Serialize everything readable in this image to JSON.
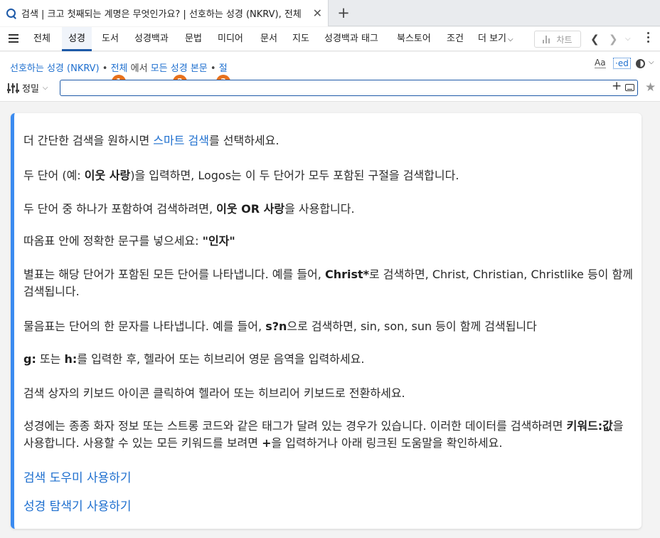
{
  "browser_tab": {
    "title": "검색 | 크고 첫째되는 계명은 무엇인가요? | 선호하는 성경 (NKRV), 전체",
    "close": "✕",
    "new_tab": "+"
  },
  "menu": {
    "items": [
      "전체",
      "성경",
      "도서",
      "성경백과",
      "문법",
      "미디어",
      "문서",
      "지도",
      "성경백과 태그",
      "북스토어",
      "조건",
      "더 보기"
    ],
    "more_caret": "⌵",
    "chart_label": "차트",
    "back": "❮",
    "forward": "❯",
    "forward_caret": "⌵"
  },
  "search": {
    "breadcrumb": {
      "bible": "선호하는 성경 (NKRV)",
      "sep1": "•",
      "scope": "전체",
      "in_text": "에서",
      "field": "모든 성경 본문",
      "sep2": "•",
      "unit": "절"
    },
    "badges": [
      "1",
      "2",
      "3"
    ],
    "aa_label": "Aa",
    "ed_label": "·ed",
    "caret": "⌵",
    "precision_label": "정밀",
    "precision_caret": "⌵",
    "input_value": "",
    "input_placeholder": "",
    "plus": "+",
    "star": "★"
  },
  "help": {
    "p1": {
      "a": "더 간단한 검색을 원하시면 ",
      "link": "스마트 검색",
      "b": "를 선택하세요."
    },
    "p2": {
      "a": "두 단어 (예: ",
      "bold": "이웃 사랑",
      "b": ")을 입력하면, Logos는 이 두 단어가 모두 포함된 구절을 검색합니다."
    },
    "p3": {
      "a": "두 단어 중 하나가 포함하여 검색하려면, ",
      "bold": "이웃 OR 사랑",
      "b": "을 사용합니다."
    },
    "p4": {
      "a": "따옴표 안에 정확한 문구를 넣으세요: ",
      "bold": "\"인자\""
    },
    "p5": {
      "a": "별표는 해당 단어가 포함된 모든 단어를 나타냅니다. 예를 들어, ",
      "bold": "Christ*",
      "b": "로 검색하면, Christ, Christian, Christlike 등이 함께 검색됩니다."
    },
    "p6": {
      "a": "물음표는 단어의 한 문자를 나타냅니다. 예를 들어,  ",
      "bold": "s?n",
      "b": "으로 검색하면, sin, son, sun 등이 함께 검색됩니다"
    },
    "p7": {
      "bold1": "g:",
      "a": " 또는 ",
      "bold2": "h:",
      "b": "를 입력한 후, 헬라어 또는 히브리어 영문 음역을 입력하세요."
    },
    "p8": "검색 상자의 키보드 아이콘 클릭하여 헬라어 또는 히브리어 키보드로 전환하세요.",
    "p9": {
      "a": "성경에는 종종 화자 정보 또는 스트롱 코드와 같은 태그가 달려 있는 경우가 있습니다.  이러한 데이터를 검색하려면 ",
      "bold": "키워드:값",
      "b": "을 사용합니다. 사용할 수 있는 모든 키워드를 보려면 ",
      "bold2": "+",
      "c": "을 입력하거나 아래 링크된 도움말을 확인하세요."
    },
    "link1": "검색 도우미 사용하기",
    "link2": "성경 탐색기 사용하기"
  },
  "colors": {
    "accent": "#1e6fcf",
    "badge": "#e8711c",
    "card_bar": "#3b8bf0"
  }
}
